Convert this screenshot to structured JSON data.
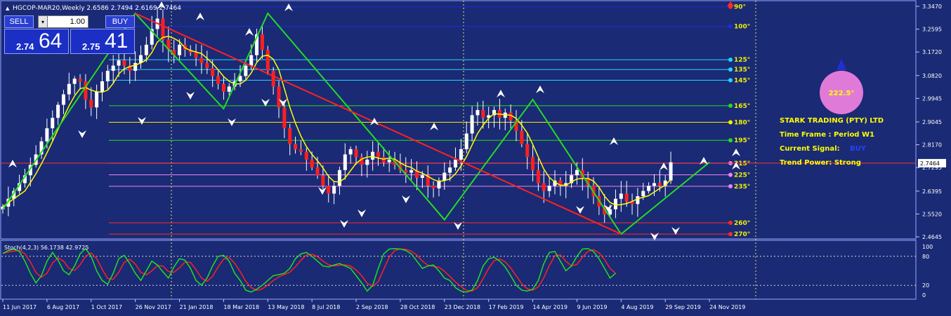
{
  "chart_header": {
    "symbol_info": "HGCOP-MAR20,Weekly",
    "ohlc": "2.6586 2.7494 2.6169 2.7464"
  },
  "trade_panel": {
    "sell_label": "SELL",
    "buy_label": "BUY",
    "lot": "1.00",
    "bid_small": "2.74",
    "bid_big": "64",
    "ask_small": "2.75",
    "ask_big": "41"
  },
  "gann_levels": [
    {
      "label": "90°",
      "price": 3.345,
      "color": "#1c2ed6",
      "dot": "#ff2a2a"
    },
    {
      "label": "100°",
      "price": 3.27,
      "color": "#1c2ed6",
      "dot": "#1c2ed6"
    },
    {
      "label": "125°",
      "price": 3.1425,
      "color": "#1fd6ff",
      "dot": "#1fd6ff"
    },
    {
      "label": "135°",
      "price": 3.105,
      "color": "#1fd6ff",
      "dot": "#1fd6ff"
    },
    {
      "label": "145°",
      "price": 3.064,
      "color": "#1fd6ff",
      "dot": "#1fd6ff"
    },
    {
      "label": "165°",
      "price": 2.9665,
      "color": "#22dd22",
      "dot": "#22dd22"
    },
    {
      "label": "180°",
      "price": 2.903,
      "color": "#f0f000",
      "dot": "#f0f000"
    },
    {
      "label": "195°",
      "price": 2.834,
      "color": "#22dd22",
      "dot": "#22dd22"
    },
    {
      "label": "215°",
      "price": 2.7464,
      "color": "#ee82ee",
      "dot": "#ee82ee"
    },
    {
      "label": "225°",
      "price": 2.702,
      "color": "#ee82ee",
      "dot": "#ee82ee"
    },
    {
      "label": "235°",
      "price": 2.658,
      "color": "#ee82ee",
      "dot": "#ee82ee"
    },
    {
      "label": "260°",
      "price": 2.518,
      "color": "#ff2a2a",
      "dot": "#ff2a2a"
    },
    {
      "label": "270°",
      "price": 2.475,
      "color": "#ff2a2a",
      "dot": "#ff2a2a"
    }
  ],
  "price_axis": {
    "ticks": [
      "3.3470",
      "3.2595",
      "3.1720",
      "3.0820",
      "2.9945",
      "2.9045",
      "2.8170",
      "2.7295",
      "2.6395",
      "2.5520",
      "2.4645"
    ],
    "current_price": "2.7464"
  },
  "info_panel": {
    "angle_badge": "222.5°",
    "company": "STARK TRADING (PTY) LTD",
    "timeframe": "Time Frame : Period W1",
    "signal_label": "Current Signal:",
    "signal_value": "BUY",
    "trend": "Trend Power: Strong"
  },
  "stoch": {
    "label": "Stoch(4,2,3) 56.1738 42.9725",
    "axis_ticks": [
      "100",
      "80",
      "20",
      "0"
    ]
  },
  "time_axis": {
    "labels": [
      "11 Jun 2017",
      "6 Aug 2017",
      "1 Oct 2017",
      "26 Nov 2017",
      "21 Jan 2018",
      "18 Mar 2018",
      "13 May 2018",
      "8 Jul 2018",
      "2 Sep 2018",
      "28 Oct 2018",
      "23 Dec 2018",
      "17 Feb 2019",
      "14 Apr 2019",
      "9 Jun 2019",
      "4 Aug 2019",
      "29 Sep 2019",
      "24 Nov 2019"
    ]
  },
  "chart_data": {
    "type": "candlestick",
    "price_range": [
      2.4645,
      3.347
    ],
    "zigzag": [
      [
        "2017-06-11",
        2.57
      ],
      [
        "2017-11-26",
        3.32
      ],
      [
        "2018-03-18",
        2.955
      ],
      [
        "2018-05-13",
        3.32
      ],
      [
        "2018-12-23",
        2.53
      ],
      [
        "2019-04-14",
        2.99
      ],
      [
        "2019-08-04",
        2.475
      ],
      [
        "2019-11-24",
        2.75
      ]
    ],
    "trendline": [
      [
        "2017-11-26",
        3.32
      ],
      [
        "2019-08-04",
        2.475
      ]
    ],
    "close": [
      2.58,
      2.61,
      2.64,
      2.67,
      2.7,
      2.74,
      2.78,
      2.83,
      2.88,
      2.92,
      2.97,
      3.01,
      3.05,
      3.07,
      3.06,
      2.99,
      2.96,
      3.02,
      3.06,
      3.1,
      3.12,
      3.14,
      3.12,
      3.1,
      3.13,
      3.16,
      3.2,
      3.26,
      3.3,
      3.22,
      3.18,
      3.16,
      3.2,
      3.18,
      3.17,
      3.15,
      3.13,
      3.11,
      3.08,
      3.05,
      3.02,
      3.04,
      3.06,
      3.08,
      3.12,
      3.16,
      3.24,
      3.18,
      3.1,
      3.04,
      2.96,
      2.88,
      2.82,
      2.8,
      2.79,
      2.76,
      2.73,
      2.7,
      2.66,
      2.63,
      2.66,
      2.72,
      2.78,
      2.8,
      2.77,
      2.74,
      2.76,
      2.79,
      2.77,
      2.75,
      2.76,
      2.74,
      2.72,
      2.71,
      2.72,
      2.69,
      2.7,
      2.66,
      2.65,
      2.68,
      2.71,
      2.73,
      2.76,
      2.8,
      2.86,
      2.93,
      2.95,
      2.92,
      2.93,
      2.95,
      2.92,
      2.94,
      2.91,
      2.87,
      2.82,
      2.77,
      2.72,
      2.67,
      2.64,
      2.66,
      2.68,
      2.66,
      2.67,
      2.7,
      2.72,
      2.69,
      2.66,
      2.62,
      2.58,
      2.55,
      2.57,
      2.61,
      2.63,
      2.6,
      2.59,
      2.62,
      2.64,
      2.66,
      2.67,
      2.66,
      2.68,
      2.75
    ],
    "stoch_k": [
      86,
      92,
      95,
      90,
      70,
      45,
      25,
      40,
      70,
      88,
      72,
      50,
      42,
      60,
      85,
      96,
      80,
      50,
      30,
      22,
      45,
      75,
      82,
      65,
      45,
      30,
      50,
      70,
      62,
      48,
      35,
      58,
      75,
      72,
      55,
      30,
      20,
      35,
      60,
      80,
      82,
      70,
      45,
      30,
      10,
      6,
      12,
      20,
      30,
      40,
      42,
      45,
      55,
      75,
      85,
      88,
      80,
      70,
      60,
      58,
      62,
      65,
      60,
      55,
      40,
      25,
      8,
      20,
      55,
      85,
      95,
      96,
      95,
      92,
      85,
      70,
      55,
      60,
      62,
      50,
      35,
      30,
      15,
      8,
      6,
      10,
      30,
      60,
      75,
      78,
      70,
      58,
      40,
      20,
      10,
      8,
      12,
      30,
      65,
      88,
      90,
      70,
      50,
      60,
      80,
      95,
      96,
      90,
      75,
      55,
      35,
      45
    ]
  }
}
